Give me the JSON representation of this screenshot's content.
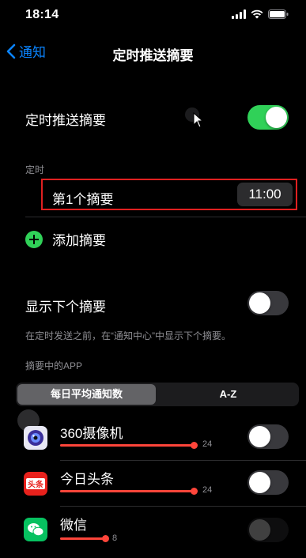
{
  "status_bar": {
    "time": "18:14"
  },
  "nav": {
    "back_label": "通知",
    "title": "定时推送摘要"
  },
  "scheduled": {
    "label": "定时推送摘要",
    "enabled": true
  },
  "schedule_section": {
    "label": "定时"
  },
  "summary": {
    "label": "第1个摘要",
    "time": "11:00"
  },
  "add_summary": {
    "label": "添加摘要"
  },
  "show_next": {
    "label": "显示下个摘要",
    "enabled": false,
    "description": "在定时发送之前，在“通知中心”中显示下个摘要。"
  },
  "apps_section": {
    "label": "摘要中的APP"
  },
  "segments": {
    "active": "每日平均通知数",
    "inactive": "A-Z"
  },
  "apps": [
    {
      "name": "360摄像机",
      "count": "24",
      "enabled": false
    },
    {
      "name": "今日头条",
      "count": "24",
      "enabled": false
    },
    {
      "name": "微信",
      "count": "8",
      "enabled": false
    }
  ],
  "colors": {
    "accent": "#0a84ff",
    "toggle_on": "#30d158",
    "highlight": "#e02020",
    "bar": "#ff453a"
  },
  "icons": [
    "signal-icon",
    "wifi-icon",
    "battery-icon",
    "back-chevron-icon",
    "plus-circle-icon",
    "camera-app-icon",
    "toutiao-app-icon",
    "wechat-app-icon",
    "cursor-icon"
  ]
}
